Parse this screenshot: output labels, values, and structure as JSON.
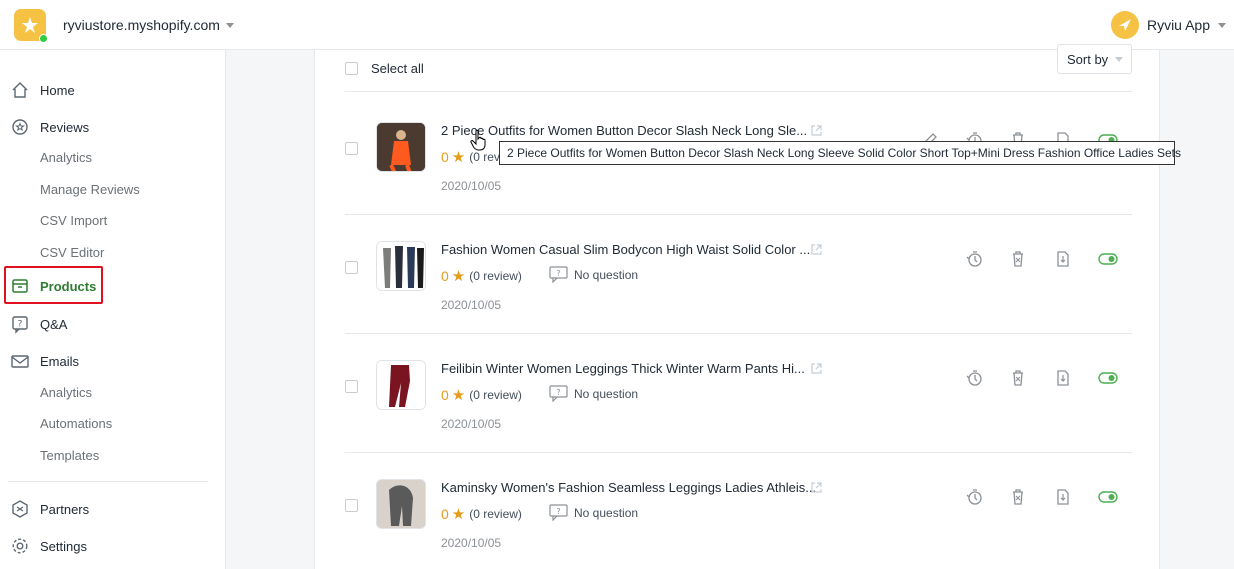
{
  "topbar": {
    "store_name": "ryviustore.myshopify.com",
    "app_name": "Ryviu App"
  },
  "sidebar": {
    "home": "Home",
    "reviews": "Reviews",
    "analytics": "Analytics",
    "manage_reviews": "Manage Reviews",
    "csv_import": "CSV Import",
    "csv_editor": "CSV Editor",
    "products": "Products",
    "qa": "Q&A",
    "emails": "Emails",
    "email_analytics": "Analytics",
    "automations": "Automations",
    "templates": "Templates",
    "partners": "Partners",
    "settings": "Settings"
  },
  "toolbar": {
    "select_all": "Select all",
    "sort_by": "Sort by"
  },
  "products": [
    {
      "title": "2 Piece Outfits for Women Button Decor Slash Neck Long Sle...",
      "rating": "0",
      "reviews": "(0 revi",
      "question": "",
      "date": "2020/10/05",
      "enabled": true,
      "thumb": "orange"
    },
    {
      "title": "Fashion Women Casual Slim Bodycon High Waist Solid Color ...",
      "rating": "0",
      "reviews": "(0 review)",
      "question": "No question",
      "date": "2020/10/05",
      "enabled": true,
      "thumb": "leggings"
    },
    {
      "title": "Feilibin Winter Women Leggings Thick Winter Warm Pants Hi...",
      "rating": "0",
      "reviews": "(0 review)",
      "question": "No question",
      "date": "2020/10/05",
      "enabled": true,
      "thumb": "maroon"
    },
    {
      "title": "Kaminsky Women's Fashion Seamless Leggings Ladies Athleis...",
      "rating": "0",
      "reviews": "(0 review)",
      "question": "No question",
      "date": "2020/10/05",
      "enabled": true,
      "thumb": "grey"
    }
  ],
  "tooltip": "2 Piece Outfits for Women Button Decor Slash Neck Long Sleeve Solid Color Short Top+Mini Dress Fashion Office Ladies Sets",
  "colors": {
    "accent_green": "#2e7d32",
    "highlight_red": "#e0121f",
    "star": "#e49c1a",
    "logo": "#f6c244"
  }
}
